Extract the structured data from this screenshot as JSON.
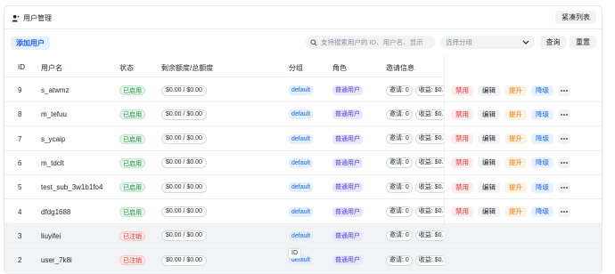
{
  "header": {
    "title": "用户管理",
    "compact_label": "紧凑列表"
  },
  "toolbar": {
    "add_label": "添加用户",
    "search_placeholder": "支持搜索用户的 ID、用户名、显示",
    "group_placeholder": "选择分组",
    "query_label": "查询",
    "reset_label": "重置"
  },
  "columns": [
    "ID",
    "用户名",
    "状态",
    "剩余额度/总额度",
    "分组",
    "角色",
    "邀请信息"
  ],
  "actions": {
    "ban": "禁用",
    "edit": "编辑",
    "promote": "提升",
    "demote": "降级"
  },
  "rows": [
    {
      "id": "9",
      "username": "s_atwmz",
      "status": "已启用",
      "quota": "$0.00 / $0.00",
      "group": "default",
      "role": "普通用户",
      "invites": "邀请: 0",
      "earnings": "收益: $0.",
      "disabled": false
    },
    {
      "id": "8",
      "username": "m_tefuu",
      "status": "已启用",
      "quota": "$0.00 / $0.00",
      "group": "default",
      "role": "普通用户",
      "invites": "邀请: 0",
      "earnings": "收益: $0.",
      "disabled": false
    },
    {
      "id": "7",
      "username": "s_ycaip",
      "status": "已启用",
      "quota": "$0.00 / $0.00",
      "group": "default",
      "role": "普通用户",
      "invites": "邀请: 0",
      "earnings": "收益: $0.",
      "disabled": false
    },
    {
      "id": "6",
      "username": "m_tdclt",
      "status": "已启用",
      "quota": "$0.00 / $0.00",
      "group": "default",
      "role": "普通用户",
      "invites": "邀请: 0",
      "earnings": "收益: $0.",
      "disabled": false
    },
    {
      "id": "5",
      "username": "test_sub_3w1b1fo4",
      "status": "已启用",
      "quota": "$0.00 / $0.00",
      "group": "default",
      "role": "普通用户",
      "invites": "邀请: 0",
      "earnings": "收益: $0.",
      "disabled": false
    },
    {
      "id": "4",
      "username": "dfdg1688",
      "status": "已启用",
      "quota": "$0.00 / $0.00",
      "group": "default",
      "role": "普通用户",
      "invites": "邀请: 0",
      "earnings": "收益: $0.",
      "disabled": false
    },
    {
      "id": "3",
      "username": "liuyifei",
      "status": "已注销",
      "quota": "$0.00 / $0.00",
      "group": "default",
      "role": "普通用户",
      "invites": "邀请: 0",
      "earnings": "收益: $0.",
      "disabled": true
    },
    {
      "id": "2",
      "username": "user_7k8i",
      "status": "已注销",
      "quota": "$0.00 / $0.00",
      "group": "default",
      "role": "普通用户",
      "invites": "邀请: 0",
      "earnings": "收益: $0.",
      "disabled": true
    }
  ],
  "tooltip": "ID",
  "icons": {
    "header": "user-icon",
    "search": "search-icon",
    "select": "chevron-down-icon",
    "more": "more-icon"
  }
}
